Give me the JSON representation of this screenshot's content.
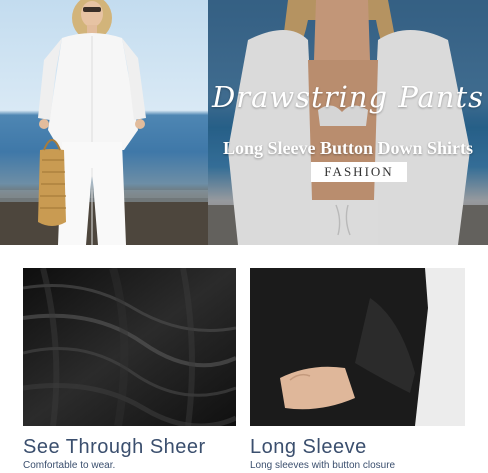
{
  "banner": {
    "script_title": "Drawstring Pants",
    "title": "Long Sleeve Button Down Shirts",
    "badge": "FASHION"
  },
  "features": [
    {
      "title": "See Through Sheer",
      "subtitle": "Comfortable to wear."
    },
    {
      "title": "Long Sleeve",
      "subtitle": "Long sleeves with button closure"
    }
  ],
  "colors": {
    "caption": "#3b4f6e",
    "fabric": "#141414"
  }
}
